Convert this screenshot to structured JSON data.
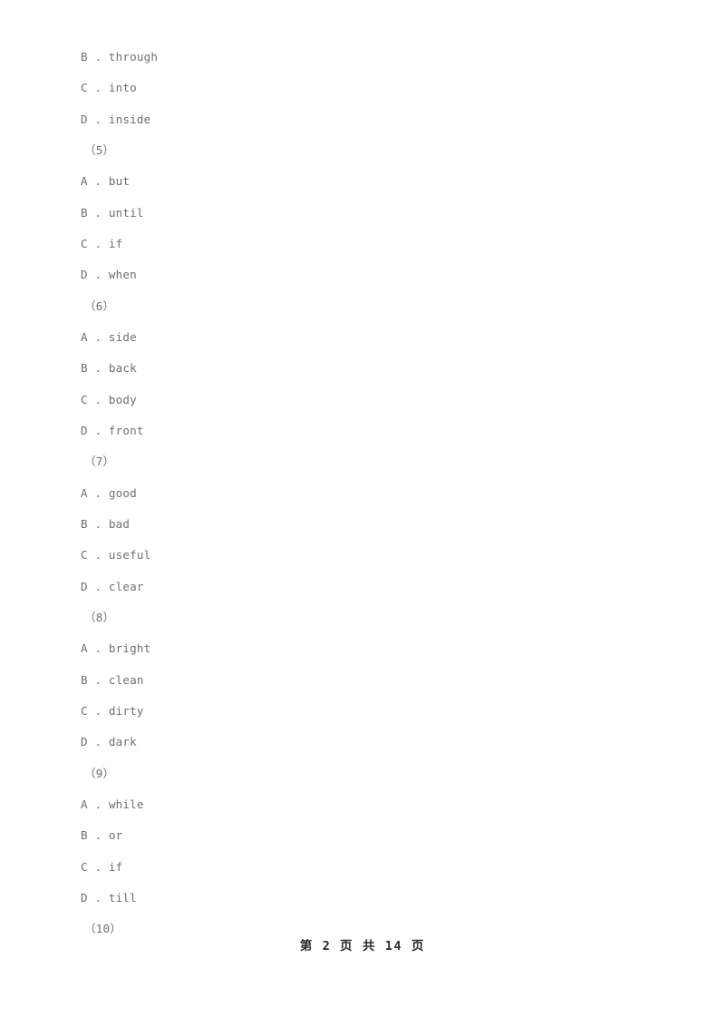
{
  "document": {
    "background_color": "#ffffff",
    "text_color": "#6f6f6f",
    "footer_color": "#2b2b2b"
  },
  "body_lines": [
    {
      "kind": "option",
      "text": "B . through"
    },
    {
      "kind": "option",
      "text": "C . into"
    },
    {
      "kind": "option",
      "text": "D . inside"
    },
    {
      "kind": "qnum",
      "text": "（5）"
    },
    {
      "kind": "option",
      "text": "A . but"
    },
    {
      "kind": "option",
      "text": "B . until"
    },
    {
      "kind": "option",
      "text": "C . if"
    },
    {
      "kind": "option",
      "text": "D . when"
    },
    {
      "kind": "qnum",
      "text": "（6）"
    },
    {
      "kind": "option",
      "text": "A . side"
    },
    {
      "kind": "option",
      "text": "B . back"
    },
    {
      "kind": "option",
      "text": "C . body"
    },
    {
      "kind": "option",
      "text": "D . front"
    },
    {
      "kind": "qnum",
      "text": "（7）"
    },
    {
      "kind": "option",
      "text": "A . good"
    },
    {
      "kind": "option",
      "text": "B . bad"
    },
    {
      "kind": "option",
      "text": "C . useful"
    },
    {
      "kind": "option",
      "text": "D . clear"
    },
    {
      "kind": "qnum",
      "text": "（8）"
    },
    {
      "kind": "option",
      "text": "A . bright"
    },
    {
      "kind": "option",
      "text": "B . clean"
    },
    {
      "kind": "option",
      "text": "C . dirty"
    },
    {
      "kind": "option",
      "text": "D . dark"
    },
    {
      "kind": "qnum",
      "text": "（9）"
    },
    {
      "kind": "option",
      "text": "A . while"
    },
    {
      "kind": "option",
      "text": "B . or"
    },
    {
      "kind": "option",
      "text": "C . if"
    },
    {
      "kind": "option",
      "text": "D . till"
    },
    {
      "kind": "qnum",
      "text": "（10）"
    }
  ],
  "footer": {
    "text": "第 2 页 共 14 页",
    "current_page": "2",
    "total_pages": "14"
  }
}
